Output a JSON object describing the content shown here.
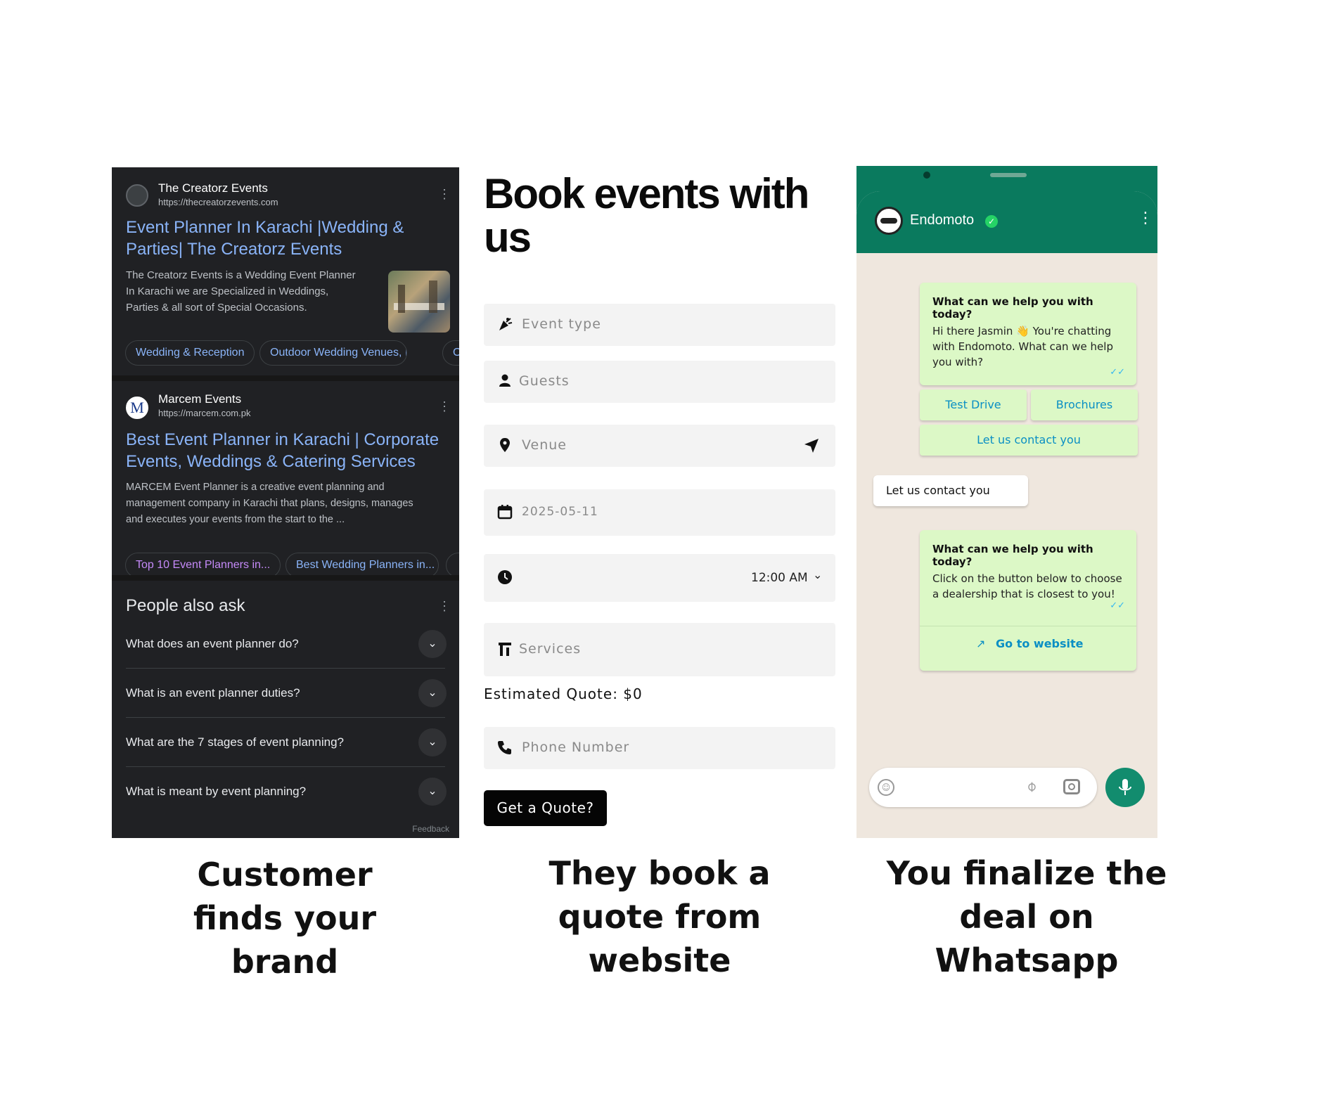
{
  "search": {
    "results": [
      {
        "site_name": "The Creatorz Events",
        "url": "https://thecreatorzevents.com",
        "title": "Event Planner In Karachi |Wedding & Parties| The Creatorz Events",
        "snippet": [
          "The Creatorz Events is a Wedding Event Planner",
          "In Karachi we are Specialized in Weddings,",
          "Parties & all sort of Special Occasions."
        ],
        "chips": [
          "Wedding & Reception",
          "Outdoor Wedding Venues, In..."
        ]
      },
      {
        "site_name": "Marcem Events",
        "url": "https://marcem.com.pk",
        "favicon_letter": "M",
        "title": "Best Event Planner in Karachi | Corporate Events, Weddings & Catering Services",
        "snippet": [
          "MARCEM Event Planner is a creative event planning and",
          "management company in Karachi that plans, designs, manages",
          "and executes your events from the start to the ..."
        ],
        "chips": [
          "Top 10 Event Planners in...",
          "Best Wedding Planners in..."
        ]
      }
    ],
    "paa": {
      "title": "People also ask",
      "questions": [
        "What does an event planner do?",
        "What is an event planner duties?",
        "What are the 7 stages of event planning?",
        "What is meant by event planning?"
      ]
    },
    "feedback": "Feedback"
  },
  "form": {
    "title": "Book events with us",
    "fields": {
      "event_type": "Event type",
      "guests": "Guests",
      "venue": "Venue",
      "date": "2025-05-11",
      "time": "12:00 AM",
      "services": "Services",
      "phone": "Phone Number"
    },
    "estimate": "Estimated Quote: $0",
    "button": "Get a Quote?"
  },
  "whatsapp": {
    "contact": "Endomoto",
    "msg1_heading": "What can we help you with today?",
    "msg1_body": [
      "Hi there Jasmin 👋 You're chatting",
      "with Endomoto. What can we help",
      "you with?"
    ],
    "btn_test_drive": "Test Drive",
    "btn_brochures": "Brochures",
    "btn_contact": "Let us contact you",
    "reply": "Let us contact you",
    "msg2_heading": "What can we help you with today?",
    "msg2_body": [
      "Click on the button below to choose",
      "a dealership that is closest to you!"
    ],
    "btn_website": "Go to website",
    "accent": "#0a7a5e"
  },
  "captions": {
    "c1": [
      "Customer",
      "finds your",
      "brand"
    ],
    "c2": [
      "They book a",
      "quote from",
      "website"
    ],
    "c3": [
      "You finalize the",
      "deal on",
      "Whatsapp"
    ]
  }
}
